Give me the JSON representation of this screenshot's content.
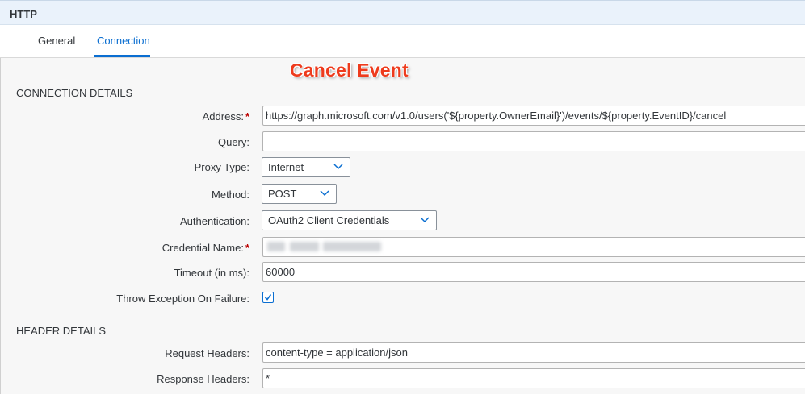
{
  "window": {
    "title": "HTTP"
  },
  "tabs": [
    {
      "label": "General",
      "active": false
    },
    {
      "label": "Connection",
      "active": true
    }
  ],
  "annotation": "Cancel Event",
  "sections": {
    "connection": "CONNECTION DETAILS",
    "header": "HEADER DETAILS"
  },
  "fields": {
    "address": {
      "label": "Address:",
      "required": "*",
      "value": "https://graph.microsoft.com/v1.0/users('${property.OwnerEmail}')/events/${property.EventID}/cancel"
    },
    "query": {
      "label": "Query:",
      "value": ""
    },
    "proxy_type": {
      "label": "Proxy Type:",
      "value": "Internet"
    },
    "method": {
      "label": "Method:",
      "value": "POST"
    },
    "authentication": {
      "label": "Authentication:",
      "value": "OAuth2 Client Credentials"
    },
    "credential_name": {
      "label": "Credential Name:",
      "required": "*"
    },
    "timeout": {
      "label": "Timeout (in ms):",
      "value": "60000"
    },
    "throw_exception": {
      "label": "Throw Exception On Failure:",
      "checked": true
    },
    "request_headers": {
      "label": "Request Headers:",
      "value": "content-type = application/json"
    },
    "response_headers": {
      "label": "Response Headers:",
      "value": "*"
    }
  },
  "colors": {
    "accent": "#0a6ed1",
    "required": "#bb0000",
    "annotation": "#ee3b1d"
  },
  "icons": {
    "dropdown": "chevron-down-icon",
    "check": "checkmark-icon"
  }
}
